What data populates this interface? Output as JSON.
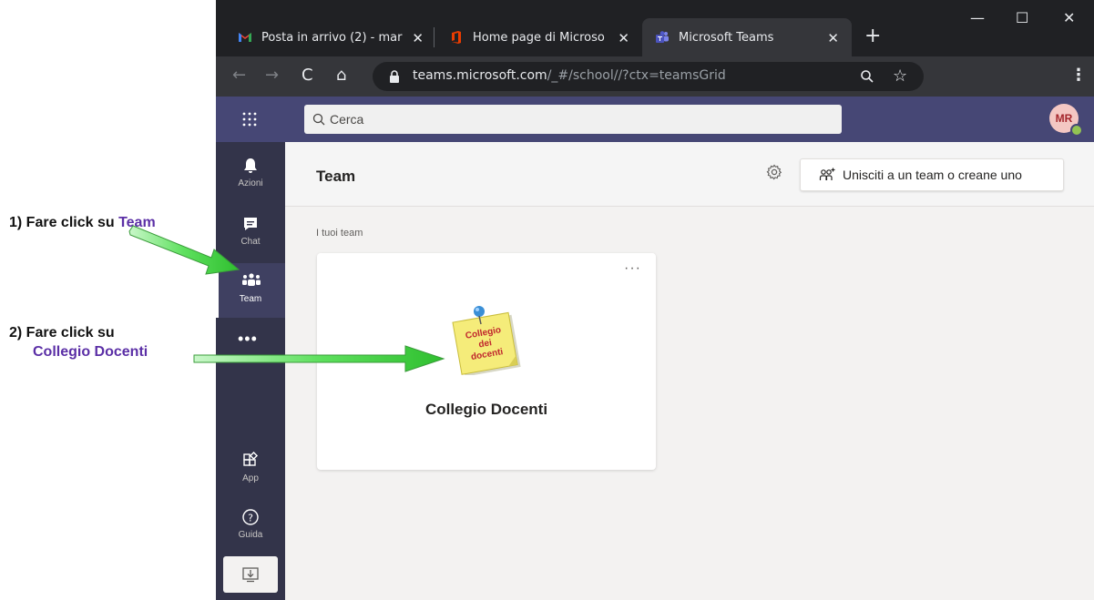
{
  "browser": {
    "tabs": [
      {
        "title": "Posta in arrivo (2) - mar",
        "icon": "gmail-icon",
        "active": false
      },
      {
        "title": "Home page di Microso",
        "icon": "office-icon",
        "active": false
      },
      {
        "title": "Microsoft Teams",
        "icon": "teams-icon",
        "active": true
      }
    ],
    "new_tab": "+",
    "url_domain": "teams.microsoft.com",
    "url_path": "/_#/school//?ctx=teamsGrid"
  },
  "teams": {
    "search_placeholder": "Cerca",
    "avatar_initials": "MR",
    "rail": [
      {
        "label": "Azioni",
        "icon": "bell-icon"
      },
      {
        "label": "Chat",
        "icon": "chat-icon"
      },
      {
        "label": "Team",
        "icon": "teams-people-icon",
        "active": true
      },
      {
        "label": "",
        "icon": "more-icon"
      },
      {
        "label": "App",
        "icon": "apps-icon"
      },
      {
        "label": "Guida",
        "icon": "help-icon"
      },
      {
        "label": "",
        "icon": "download-icon"
      }
    ],
    "page_title": "Team",
    "join_button": "Unisciti a un team o creane uno",
    "section_label": "I tuoi team",
    "team_card": {
      "name": "Collegio Docenti",
      "more": "···",
      "logo_text": [
        "Collegio",
        "dei",
        "docenti"
      ]
    }
  },
  "annotations": {
    "step1_prefix": "1) Fare click su ",
    "step1_highlight": "Team",
    "step2_line1": "2) Fare click su",
    "step2_highlight": "Collegio Docenti"
  },
  "colors": {
    "teams_header": "#464775",
    "rail": "#33344a",
    "annotation_arrow": "#5ee05e",
    "annotation_highlight": "#5b2fa6"
  }
}
